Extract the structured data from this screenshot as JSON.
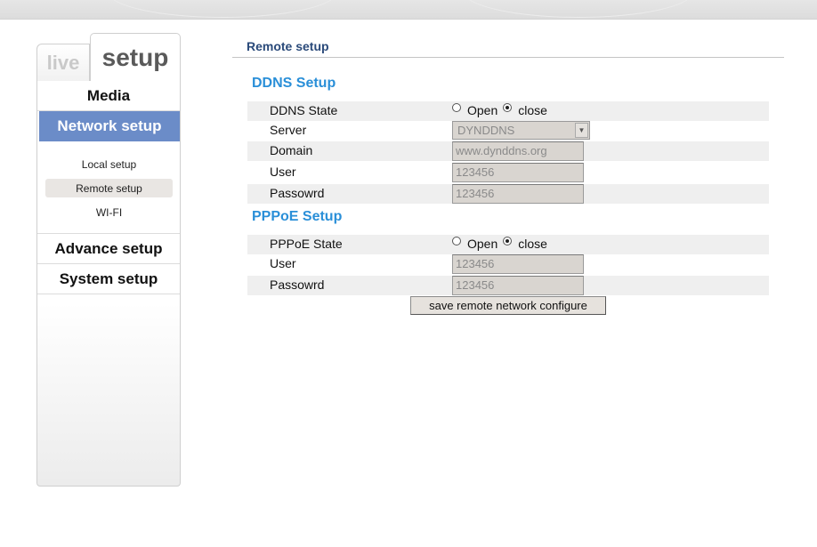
{
  "tabs": {
    "live": "live",
    "setup": "setup"
  },
  "menu": {
    "media": "Media",
    "network": "Network setup",
    "sub": [
      "Local setup",
      "Remote setup",
      "WI-FI"
    ],
    "advance": "Advance setup",
    "system": "System setup"
  },
  "page": {
    "title": "Remote setup"
  },
  "ddns": {
    "title": "DDNS Setup",
    "state_label": "DDNS State",
    "open": "Open",
    "close": "close",
    "selected": "close",
    "server_label": "Server",
    "server_value": "DYNDDNS",
    "domain_label": "Domain",
    "domain_value": "www.dynddns.org",
    "user_label": "User",
    "user_value": "123456",
    "password_label": "Passowrd",
    "password_value": "123456"
  },
  "pppoe": {
    "title": "PPPoE Setup",
    "state_label": "PPPoE State",
    "open": "Open",
    "close": "close",
    "selected": "close",
    "user_label": "User",
    "user_value": "123456",
    "password_label": "Passowrd",
    "password_value": "123456"
  },
  "actions": {
    "save": "save remote network configure"
  },
  "colors": {
    "accent": "#6b8cc8",
    "section_title": "#2a8fd8",
    "page_title": "#2a4a7a"
  }
}
